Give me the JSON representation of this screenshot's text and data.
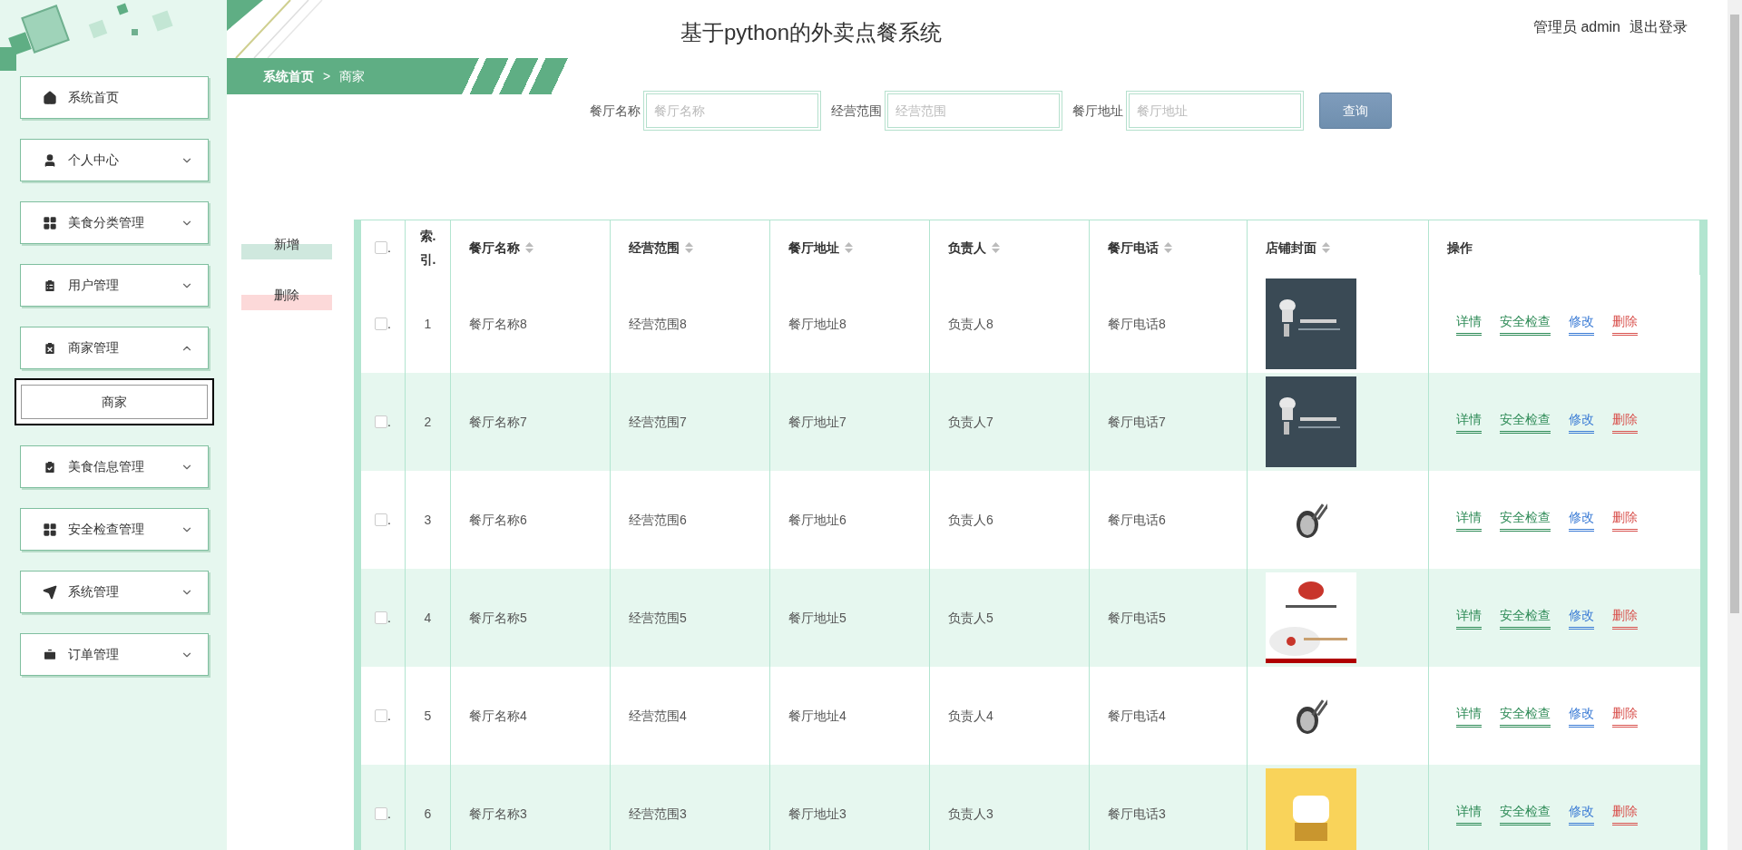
{
  "header": {
    "title": "基于python的外卖点餐系统",
    "user": "管理员 admin",
    "logout": "退出登录"
  },
  "breadcrumb": [
    "系统首页",
    ">",
    "商家"
  ],
  "sidebar": {
    "items": [
      {
        "label": "系统首页",
        "kind": "link"
      },
      {
        "label": "个人中心",
        "kind": "menu",
        "expanded": false
      },
      {
        "label": "美食分类管理",
        "kind": "menu",
        "expanded": false
      },
      {
        "label": "用户管理",
        "kind": "menu",
        "expanded": false
      },
      {
        "label": "商家管理",
        "kind": "menu",
        "expanded": true,
        "children": [
          {
            "label": "商家",
            "selected": true
          }
        ]
      },
      {
        "label": "美食信息管理",
        "kind": "menu",
        "expanded": false
      },
      {
        "label": "安全检查管理",
        "kind": "menu",
        "expanded": false
      },
      {
        "label": "系统管理",
        "kind": "menu",
        "expanded": false
      },
      {
        "label": "订单管理",
        "kind": "menu",
        "expanded": false
      }
    ]
  },
  "search": {
    "fields": [
      {
        "label": "餐厅名称",
        "placeholder": "餐厅名称"
      },
      {
        "label": "经营范围",
        "placeholder": "经营范围"
      },
      {
        "label": "餐厅地址",
        "placeholder": "餐厅地址"
      }
    ],
    "button": "查询"
  },
  "side_buttons": [
    {
      "label": "新增",
      "kind": "add"
    },
    {
      "label": "删除",
      "kind": "delete"
    }
  ],
  "table": {
    "checkbox_label": ".",
    "checked": false,
    "columns": [
      {
        "label": "索.引.",
        "sortable": false
      },
      {
        "label": "餐厅名称",
        "sortable": true
      },
      {
        "label": "经营范围",
        "sortable": true
      },
      {
        "label": "餐厅地址",
        "sortable": true
      },
      {
        "label": "负责人",
        "sortable": true
      },
      {
        "label": "餐厅电话",
        "sortable": true
      },
      {
        "label": "店铺封面",
        "sortable": true
      },
      {
        "label": "操作",
        "sortable": false
      }
    ],
    "rows": [
      {
        "checkbox_label": ".",
        "checked": false,
        "cells": [
          "1",
          "餐厅名称8",
          "经营范围8",
          "餐厅地址8",
          "负责人8",
          "餐厅电话8"
        ],
        "actions": [
          {
            "label": "详情",
            "kind": "detail"
          },
          {
            "label": "安全检查",
            "kind": "detail"
          },
          {
            "label": "修改",
            "kind": "edit"
          },
          {
            "label": "删除",
            "kind": "delete"
          }
        ]
      },
      {
        "checkbox_label": ".",
        "checked": false,
        "cells": [
          "2",
          "餐厅名称7",
          "经营范围7",
          "餐厅地址7",
          "负责人7",
          "餐厅电话7"
        ],
        "actions": [
          {
            "label": "详情",
            "kind": "detail"
          },
          {
            "label": "安全检查",
            "kind": "detail"
          },
          {
            "label": "修改",
            "kind": "edit"
          },
          {
            "label": "删除",
            "kind": "delete"
          }
        ]
      },
      {
        "checkbox_label": ".",
        "checked": false,
        "cells": [
          "3",
          "餐厅名称6",
          "经营范围6",
          "餐厅地址6",
          "负责人6",
          "餐厅电话6"
        ],
        "actions": [
          {
            "label": "详情",
            "kind": "detail"
          },
          {
            "label": "安全检查",
            "kind": "detail"
          },
          {
            "label": "修改",
            "kind": "edit"
          },
          {
            "label": "删除",
            "kind": "delete"
          }
        ]
      },
      {
        "checkbox_label": ".",
        "checked": false,
        "cells": [
          "4",
          "餐厅名称5",
          "经营范围5",
          "餐厅地址5",
          "负责人5",
          "餐厅电话5"
        ],
        "actions": [
          {
            "label": "详情",
            "kind": "detail"
          },
          {
            "label": "安全检查",
            "kind": "detail"
          },
          {
            "label": "修改",
            "kind": "edit"
          },
          {
            "label": "删除",
            "kind": "delete"
          }
        ]
      },
      {
        "checkbox_label": ".",
        "checked": false,
        "cells": [
          "5",
          "餐厅名称4",
          "经营范围4",
          "餐厅地址4",
          "负责人4",
          "餐厅电话4"
        ],
        "actions": [
          {
            "label": "详情",
            "kind": "detail"
          },
          {
            "label": "安全检查",
            "kind": "detail"
          },
          {
            "label": "修改",
            "kind": "edit"
          },
          {
            "label": "删除",
            "kind": "delete"
          }
        ]
      },
      {
        "checkbox_label": ".",
        "checked": false,
        "cells": [
          "6",
          "餐厅名称3",
          "经营范围3",
          "餐厅地址3",
          "负责人3",
          "餐厅电话3"
        ],
        "actions": [
          {
            "label": "详情",
            "kind": "detail"
          },
          {
            "label": "安全检查",
            "kind": "detail"
          },
          {
            "label": "修改",
            "kind": "edit"
          },
          {
            "label": "删除",
            "kind": "delete"
          }
        ]
      }
    ]
  }
}
